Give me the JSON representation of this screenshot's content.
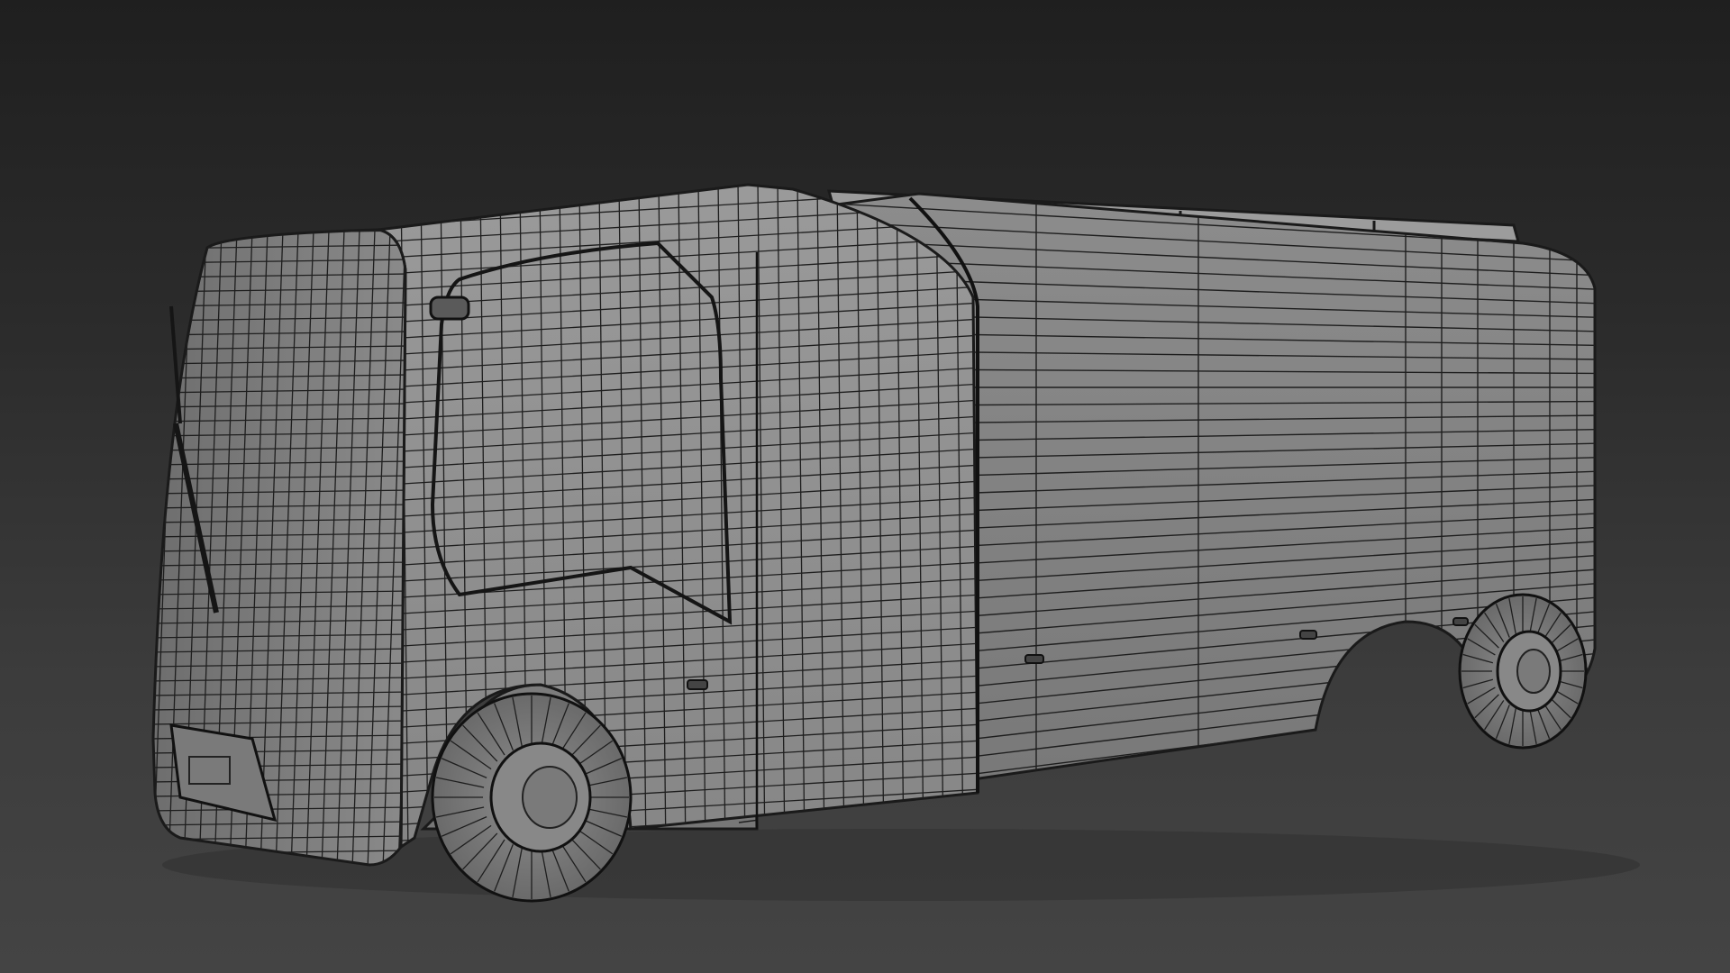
{
  "viewport": {
    "background_top": "#1f1f1f",
    "background_bottom": "#444444"
  },
  "model": {
    "shading": "grey-shaded-with-wireframe-edges",
    "body_color": "#8a8a8a",
    "wire_color": "#1a1a1a"
  }
}
